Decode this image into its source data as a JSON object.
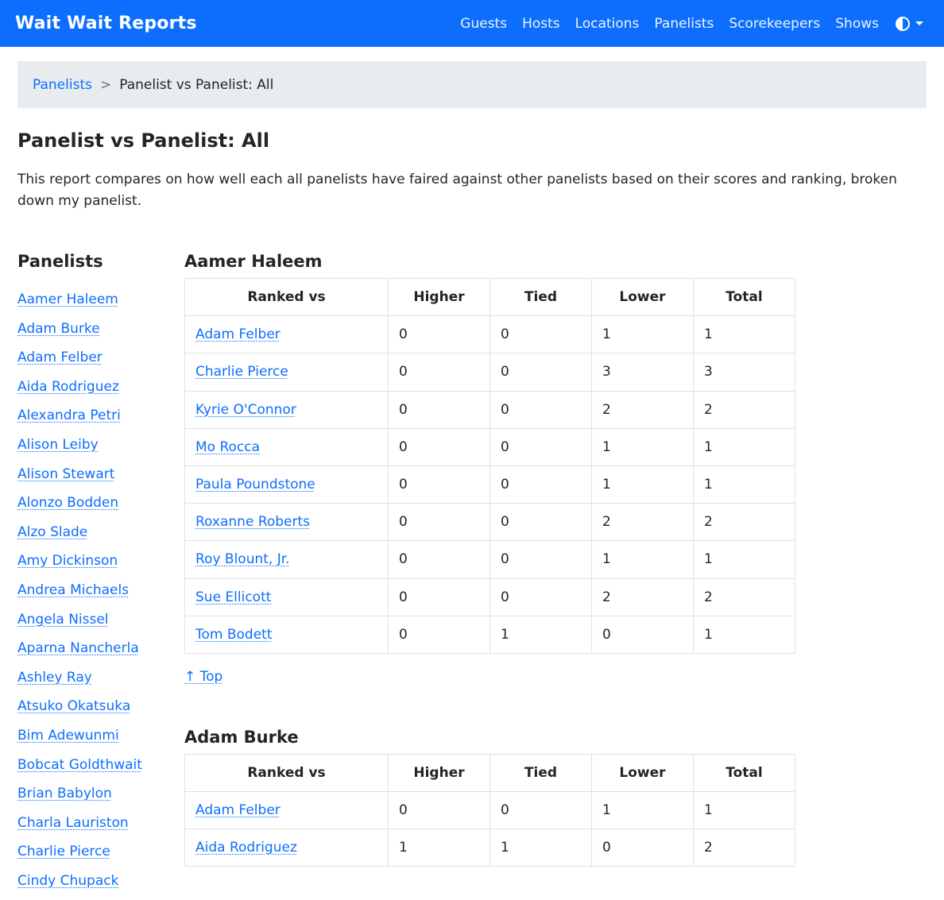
{
  "brand": "Wait Wait Reports",
  "nav": [
    "Guests",
    "Hosts",
    "Locations",
    "Panelists",
    "Scorekeepers",
    "Shows"
  ],
  "theme_icon": "contrast-icon",
  "breadcrumb": {
    "parent": "Panelists",
    "separator": ">",
    "current": "Panelist vs Panelist: All"
  },
  "page_title": "Panelist vs Panelist: All",
  "intro": "This report compares on how well each all panelists have faired against other panelists based on their scores and ranking, broken down my panelist.",
  "sidebar": {
    "title": "Panelists",
    "items": [
      "Aamer Haleem",
      "Adam Burke",
      "Adam Felber",
      "Aida Rodriguez",
      "Alexandra Petri",
      "Alison Leiby",
      "Alison Stewart",
      "Alonzo Bodden",
      "Alzo Slade",
      "Amy Dickinson",
      "Andrea Michaels",
      "Angela Nissel",
      "Aparna Nancherla",
      "Ashley Ray",
      "Atsuko Okatsuka",
      "Bim Adewunmi",
      "Bobcat Goldthwait",
      "Brian Babylon",
      "Charla Lauriston",
      "Charlie Pierce",
      "Cindy Chupack"
    ]
  },
  "table_headers": [
    "Ranked vs",
    "Higher",
    "Tied",
    "Lower",
    "Total"
  ],
  "top_link": "↑ Top",
  "sections": [
    {
      "name": "Aamer Haleem",
      "rows": [
        [
          "Adam Felber",
          "0",
          "0",
          "1",
          "1"
        ],
        [
          "Charlie Pierce",
          "0",
          "0",
          "3",
          "3"
        ],
        [
          "Kyrie O'Connor",
          "0",
          "0",
          "2",
          "2"
        ],
        [
          "Mo Rocca",
          "0",
          "0",
          "1",
          "1"
        ],
        [
          "Paula Poundstone",
          "0",
          "0",
          "1",
          "1"
        ],
        [
          "Roxanne Roberts",
          "0",
          "0",
          "2",
          "2"
        ],
        [
          "Roy Blount, Jr.",
          "0",
          "0",
          "1",
          "1"
        ],
        [
          "Sue Ellicott",
          "0",
          "0",
          "2",
          "2"
        ],
        [
          "Tom Bodett",
          "0",
          "1",
          "0",
          "1"
        ]
      ]
    },
    {
      "name": "Adam Burke",
      "rows": [
        [
          "Adam Felber",
          "0",
          "0",
          "1",
          "1"
        ],
        [
          "Aida Rodriguez",
          "1",
          "1",
          "0",
          "2"
        ]
      ]
    }
  ]
}
